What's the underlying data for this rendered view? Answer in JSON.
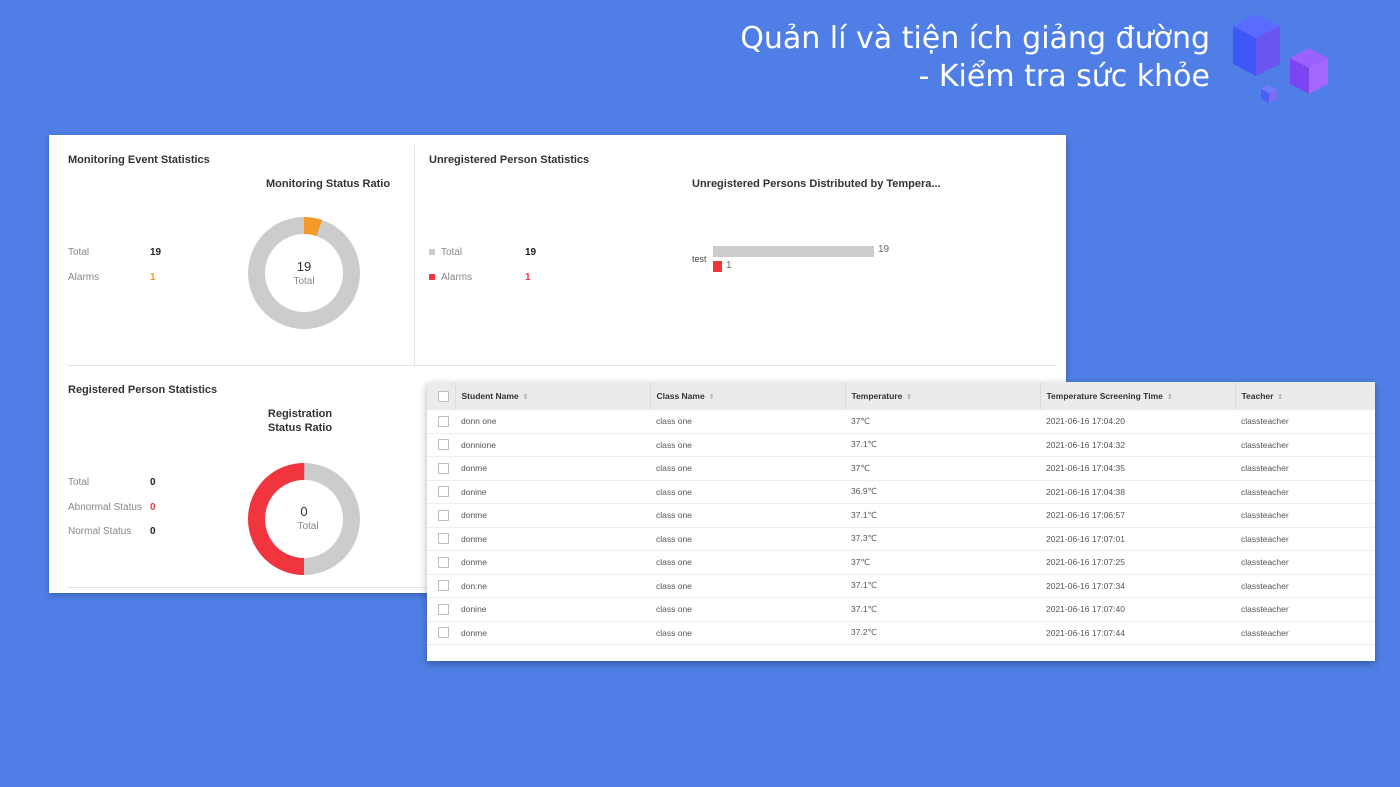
{
  "slide": {
    "title_line1": "Quản lí và tiện ích giảng đường",
    "title_line2": "- Kiểm tra sức khỏe"
  },
  "monitoring": {
    "title": "Monitoring Event Statistics",
    "ratio_title": "Monitoring Status Ratio",
    "total_label": "Total",
    "total_value": "19",
    "alarms_label": "Alarms",
    "alarms_value": "1",
    "donut_center": "19",
    "donut_sub": "Total",
    "alarm_fraction": 0.0526
  },
  "unregistered": {
    "title": "Unregistered Person Statistics",
    "chart_title": "Unregistered Persons Distributed by Tempera...",
    "total_label": "Total",
    "total_value": "19",
    "alarms_label": "Alarms",
    "alarms_value": "1"
  },
  "chart_data": {
    "type": "bar",
    "orientation": "horizontal",
    "categories": [
      "test"
    ],
    "series": [
      {
        "values": [
          19
        ],
        "color": "#cccccc"
      },
      {
        "values": [
          1
        ],
        "color": "#f0353f"
      }
    ],
    "labels": [
      "19",
      "1"
    ],
    "xlim": [
      0,
      19
    ]
  },
  "registered": {
    "title": "Registered Person Statistics",
    "ratio_title_line1": "Registration",
    "ratio_title_line2": "Status Ratio",
    "total_label": "Total",
    "total_value": "0",
    "abnormal_label": "Abnormal Status",
    "abnormal_value": "0",
    "normal_label": "Normal Status",
    "normal_value": "0",
    "donut_center": "0",
    "donut_sub": "Total",
    "red_fraction": 0.5
  },
  "table": {
    "headers": [
      "Student Name",
      "Class Name",
      "Temperature",
      "Temperature Screening Time",
      "Teacher"
    ],
    "rows": [
      [
        "donn one",
        "class one",
        "37℃",
        "2021-06-16 17:04:20",
        "classteacher"
      ],
      [
        "donnione",
        "class one",
        "37.1℃",
        "2021-06-16 17:04:32",
        "classteacher"
      ],
      [
        "donme",
        "class one",
        "37℃",
        "2021-06-16 17:04:35",
        "classteacher"
      ],
      [
        "donine",
        "class one",
        "36.9℃",
        "2021-06-16 17:04:38",
        "classteacher"
      ],
      [
        "donme",
        "class one",
        "37.1℃",
        "2021-06-16 17:06:57",
        "classteacher"
      ],
      [
        "donme",
        "class one",
        "37.3℃",
        "2021-06-16 17:07:01",
        "classteacher"
      ],
      [
        "donme",
        "class one",
        "37℃",
        "2021-06-16 17:07:25",
        "classteacher"
      ],
      [
        "don:ne",
        "class one",
        "37.1℃",
        "2021-06-16 17:07:34",
        "classteacher"
      ],
      [
        "donine",
        "class one",
        "37.1℃",
        "2021-06-16 17:07:40",
        "classteacher"
      ],
      [
        "donme",
        "class one",
        "37.2℃",
        "2021-06-16 17:07:44",
        "classteacher"
      ]
    ]
  },
  "colors": {
    "background": "#4f7fe6",
    "alarm_orange": "#f39a2b",
    "alarm_red": "#f0353f",
    "donut_gray": "#cccccc"
  }
}
